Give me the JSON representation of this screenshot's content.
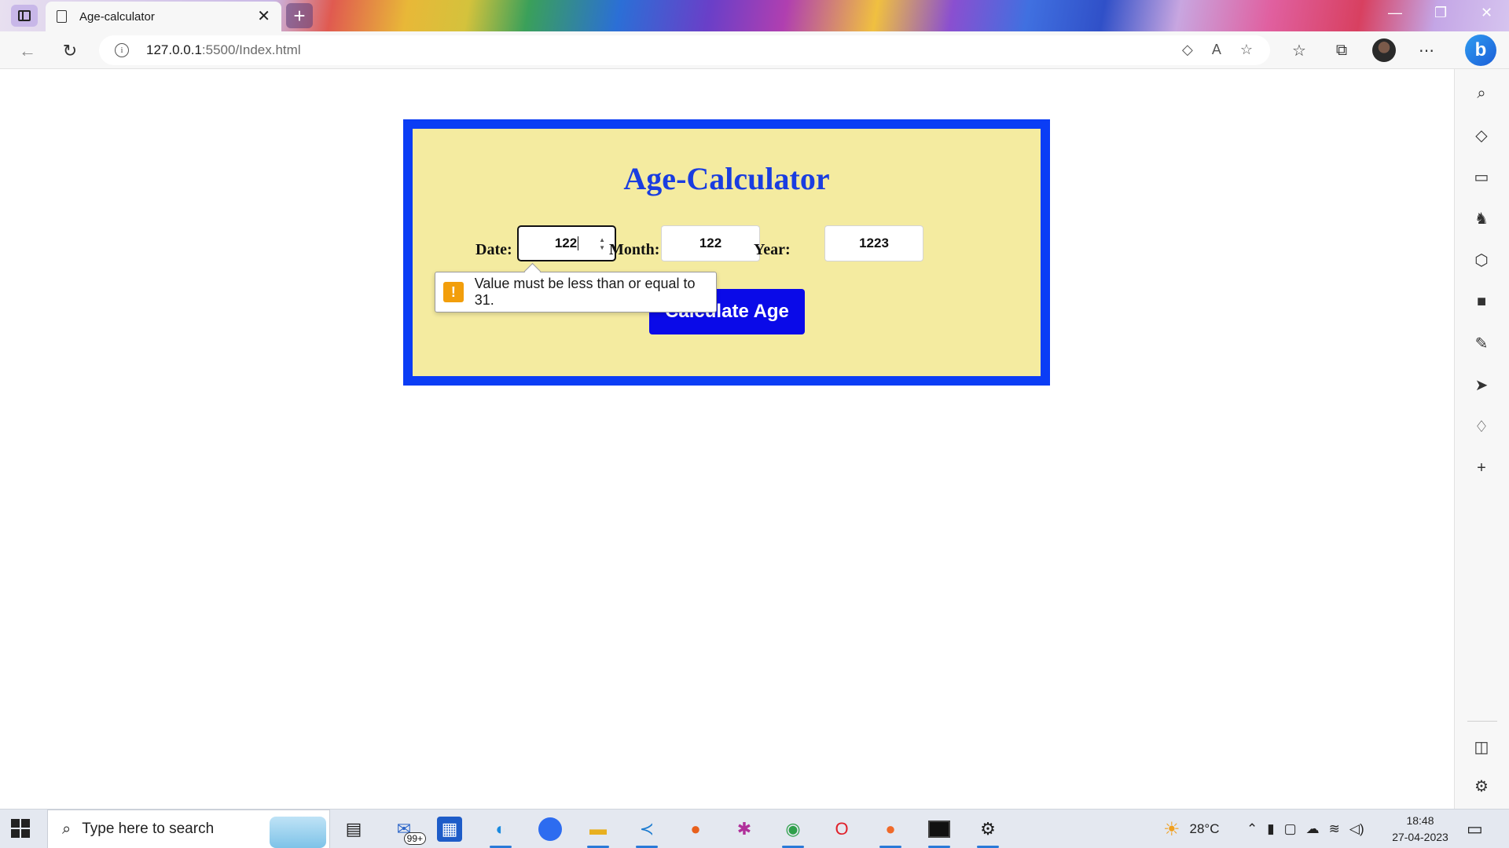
{
  "browser": {
    "tab_title": "Age-calculator",
    "tab_close_glyph": "✕",
    "new_tab_glyph": "+",
    "url_host": "127.0.0.1",
    "url_path": ":5500/Index.html",
    "info_glyph": "i",
    "window_controls": [
      "—",
      "❐",
      "✕"
    ]
  },
  "page": {
    "title": "Age-Calculator",
    "fields": [
      {
        "label": "Date:",
        "value": "122"
      },
      {
        "label": "Month:",
        "value": "122"
      },
      {
        "label": "Year:",
        "value": "1223"
      }
    ],
    "button_label": "Calculate Age",
    "validation_message": "Value must be less than or equal to 31.",
    "validation_icon": "!"
  },
  "colors": {
    "card_border": "#0b3df5",
    "card_bg": "#f4eba0",
    "title": "#1a3de0",
    "button_bg": "#0a0ae8",
    "warning": "#f29e0b"
  },
  "taskbar": {
    "search_placeholder": "Type here to search",
    "mail_badge": "99+",
    "weather": "28°C",
    "time": "18:48",
    "date": "27-04-2023"
  }
}
